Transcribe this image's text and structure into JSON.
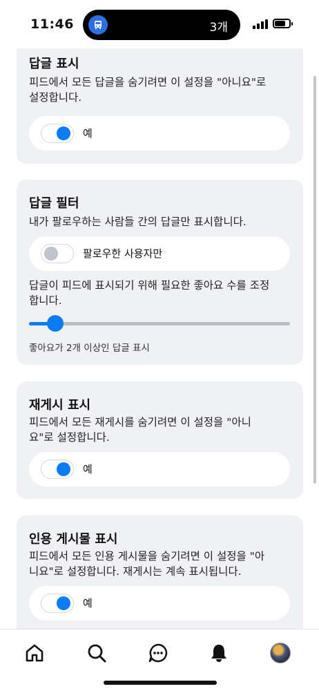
{
  "status_bar": {
    "time": "11:46",
    "island_count": "3개"
  },
  "cards": {
    "show_replies": {
      "title": "답글 표시",
      "desc_line1": "피드에서 모든 답글을 숨기려면 이 설정을 \"아니요\"로",
      "desc_line2": "설정합니다.",
      "toggle_label": "예",
      "toggle_on": true
    },
    "reply_filter": {
      "title": "답글 필터",
      "desc": "내가 팔로우하는 사람들 간의 답글만 표시합니다.",
      "toggle_label": "팔로우한 사용자만",
      "toggle_on": false,
      "slider_desc_line1": "답글이 피드에 표시되기 위해 필요한 좋아요 수를 조정",
      "slider_desc_line2": "합니다.",
      "slider_value_fraction": 0.1,
      "slider_caption": "좋아요가 2개 이상인 답글 표시"
    },
    "show_reposts": {
      "title": "재게시 표시",
      "desc_line1": "피드에서 모든 재게시를 숨기려면 이 설정을 \"아니",
      "desc_line2": "요\"로 설정합니다.",
      "toggle_label": "예",
      "toggle_on": true
    },
    "show_quotes": {
      "title": "인용 게시물 표시",
      "desc_line1": "피드에서 모든 인용 게시물을 숨기려면 이 설정을 \"아",
      "desc_line2": "니요\"로 설정합니다. 재게시는 계속 표시됩니다.",
      "toggle_label": "예",
      "toggle_on": true
    }
  },
  "nav": {
    "items": [
      "home-icon",
      "search-icon",
      "chat-icon",
      "bell-icon",
      "avatar"
    ]
  },
  "colors": {
    "accent": "#0a7cf3",
    "card_bg": "#f0f1f4"
  }
}
